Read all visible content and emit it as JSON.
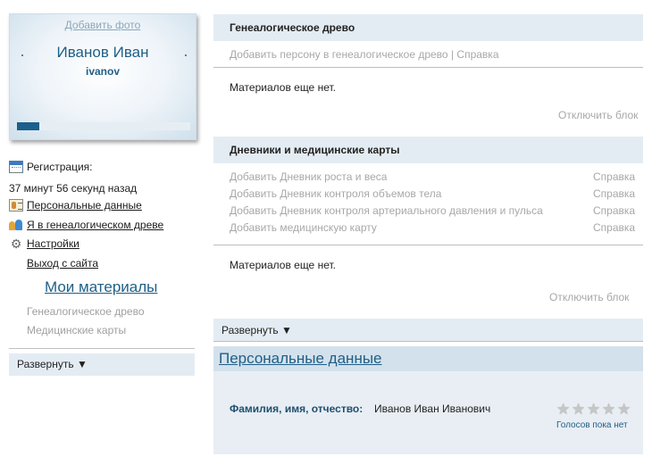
{
  "profile": {
    "add_photo": "Добавить фото",
    "name": "Иванов Иван",
    "login": "ivanov",
    "progress": 0.13
  },
  "sidebar": {
    "registration_label": "Регистрация:",
    "registration_time": "37 минут 56 секунд назад",
    "personal_data": "Персональные данные",
    "in_tree": "Я в генеалогическом древе",
    "settings": "Настройки",
    "logout": "Выход с сайта",
    "my_materials": "Мои материалы",
    "materials": [
      "Генеалогическое древо",
      "Медицинские карты"
    ],
    "expand": "Развернуть ▼"
  },
  "genealogy": {
    "title": "Генеалогическое древо",
    "add_person": "Добавить персону в генеалогическое древо",
    "separator": "|",
    "help": "Справка",
    "empty": "Материалов еще нет.",
    "disable": "Отключить блок"
  },
  "diaries": {
    "title": "Дневники и медицинские карты",
    "items": [
      {
        "label": "Добавить Дневник роста и веса",
        "help": "Справка"
      },
      {
        "label": "Добавить Дневник контроля объемов тела",
        "help": "Справка"
      },
      {
        "label": "Добавить Дневник контроля артериального давления и пульса",
        "help": "Справка"
      },
      {
        "label": "Добавить медицинскую карту",
        "help": "Справка"
      }
    ],
    "empty": "Материалов еще нет.",
    "disable": "Отключить блок"
  },
  "expand_right": "Развернуть ▼",
  "personal": {
    "title": "Персональные данные",
    "fio_label": "Фамилия, имя, отчество:",
    "fio_value": "Иванов Иван Иванович",
    "rating": 0,
    "rating_max": 5,
    "votes": "Голосов пока нет"
  }
}
